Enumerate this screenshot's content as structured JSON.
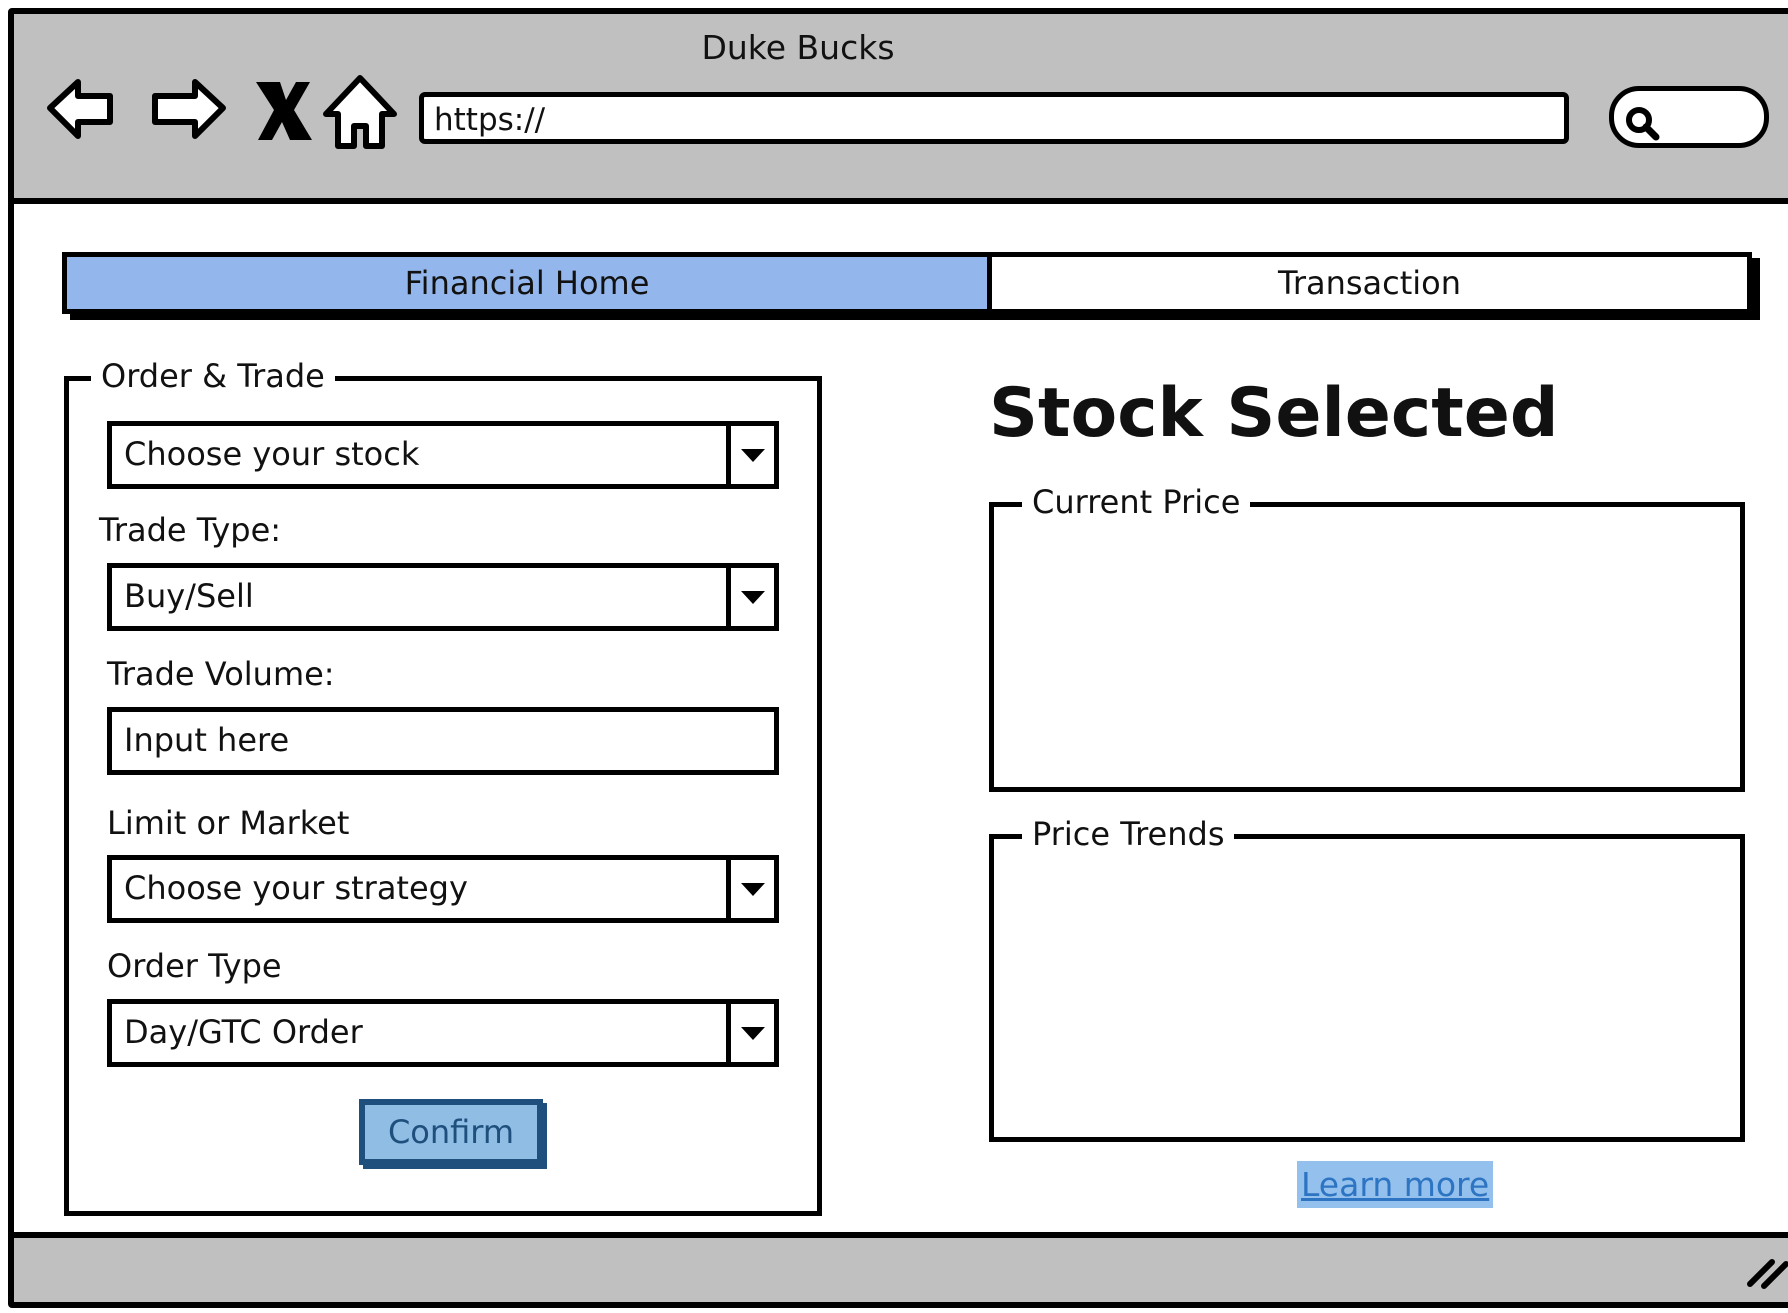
{
  "window": {
    "title": "Duke Bucks",
    "url": "https://"
  },
  "tabs": [
    {
      "label": "Financial Home",
      "active": true
    },
    {
      "label": "Transaction",
      "active": false
    }
  ],
  "order_panel": {
    "legend": "Order & Trade",
    "stock_select": "Choose your stock",
    "trade_type_label": "Trade Type:",
    "trade_type_select": "Buy/Sell",
    "trade_volume_label": "Trade Volume:",
    "trade_volume_placeholder": "Input here",
    "limit_market_label": "Limit or Market",
    "strategy_select": "Choose your strategy",
    "order_type_label": "Order Type",
    "order_type_select": "Day/GTC Order",
    "confirm_label": "Confirm"
  },
  "stock_panel": {
    "title": "Stock Selected",
    "current_price_legend": "Current Price",
    "price_trends_legend": "Price Trends",
    "learn_more": "Learn more"
  },
  "colors": {
    "active_tab": "#93b7ec",
    "chrome": "#c0c0c0",
    "button_fill": "#8fbde4",
    "button_border": "#1f4f7d",
    "link": "#2d74c2"
  }
}
